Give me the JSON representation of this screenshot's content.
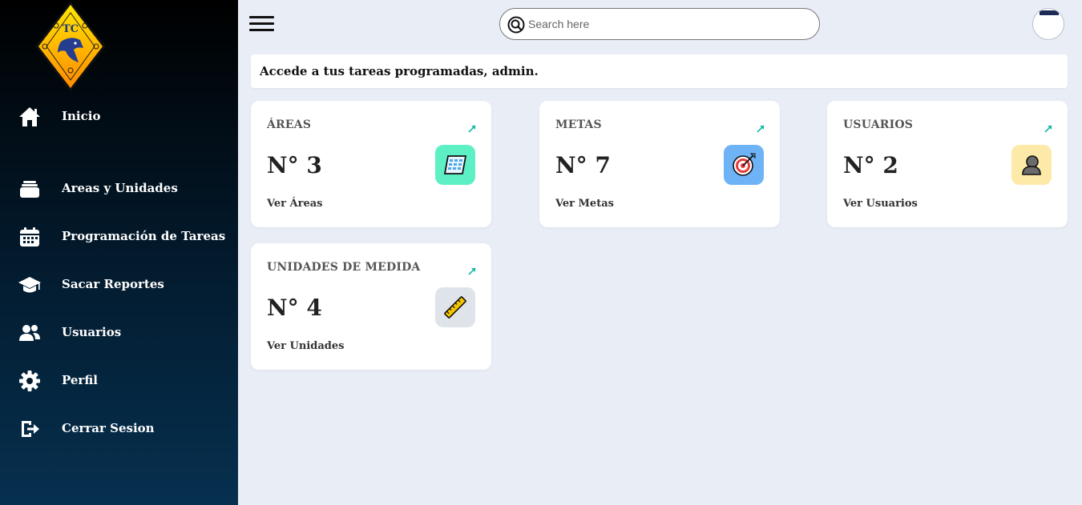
{
  "sidebar": {
    "logo_text": "TC",
    "items": [
      {
        "label": "Inicio",
        "icon": "home-icon"
      },
      {
        "label": "Areas y Unidades",
        "icon": "stack-icon"
      },
      {
        "label": "Programación de Tareas",
        "icon": "calendar-icon"
      },
      {
        "label": "Sacar Reportes",
        "icon": "graduation-cap-icon"
      },
      {
        "label": "Usuarios",
        "icon": "users-icon"
      },
      {
        "label": "Perfil",
        "icon": "gear-icon"
      },
      {
        "label": "Cerrar Sesion",
        "icon": "logout-icon"
      }
    ]
  },
  "header": {
    "search_placeholder": "Search here"
  },
  "welcome": {
    "text": "Accede a tus tareas programadas, admin."
  },
  "cards": [
    {
      "title": "ÁREAS",
      "count": "N° 3",
      "link": "Ver Áreas",
      "icon": "building-icon",
      "color": "#5ef0c5"
    },
    {
      "title": "METAS",
      "count": "N° 7",
      "link": "Ver Metas",
      "icon": "target-icon",
      "color": "#6fb3f7"
    },
    {
      "title": "USUARIOS",
      "count": "N° 2",
      "link": "Ver Usuarios",
      "icon": "user-bust-icon",
      "color": "#fde9a8"
    },
    {
      "title": "UNIDADES DE MEDIDA",
      "count": "N° 4",
      "link": "Ver Unidades",
      "icon": "ruler-icon",
      "color": "#dfe4ea"
    }
  ],
  "colors": {
    "accent_arrow": "#14b8a6",
    "background": "#e9edf5"
  }
}
